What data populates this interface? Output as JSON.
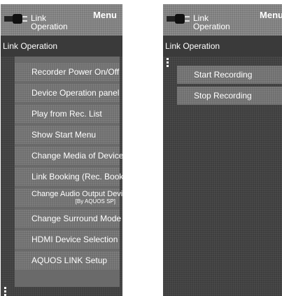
{
  "left": {
    "header_title_line1": "Link",
    "header_title_line2": "Operation",
    "menu_label": "Menu",
    "subtitle": "Link Operation",
    "items": [
      {
        "label": "Recorder Power On/Off"
      },
      {
        "label": "Device Operation panel"
      },
      {
        "label": "Play from Rec. List"
      },
      {
        "label": "Show Start Menu"
      },
      {
        "label": "Change Media of Device"
      },
      {
        "label": "Link Booking (Rec. Book)"
      },
      {
        "label": "Change Audio Output Device",
        "note": "[By AQUOS SP]"
      },
      {
        "label": "Change Surround Mode"
      },
      {
        "label": "HDMI Device Selection"
      },
      {
        "label": "AQUOS LINK Setup"
      }
    ]
  },
  "right": {
    "header_title_line1": "Link",
    "header_title_line2": "Operation",
    "menu_label": "Menu",
    "subtitle": "Link Operation",
    "items": [
      {
        "label": "Start Recording"
      },
      {
        "label": "Stop Recording"
      }
    ]
  },
  "icons": {
    "plug": "plug-icon",
    "scroll": "scroll-indicator-icon"
  }
}
